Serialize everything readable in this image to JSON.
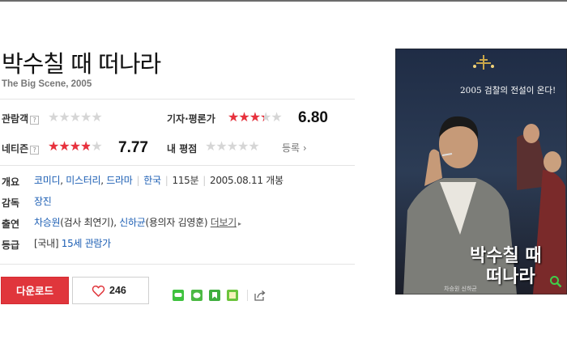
{
  "movie": {
    "title_ko": "박수칠 때 떠나라",
    "subtitle": "The Big Scene, 2005"
  },
  "ratings": {
    "audience_label": "관람객",
    "help_mark": "?",
    "audience_fraction": 0,
    "critic_label": "기자·평론가",
    "critic_score": "6.80",
    "critic_fraction": 0.68,
    "netizen_label": "네티즌",
    "netizen_score": "7.77",
    "netizen_fraction": 0.777,
    "my_label": "내 평점",
    "my_fraction": 0,
    "register_label": "등록",
    "register_arrow": "›",
    "star_glyphs": "★★★★★",
    "colors": {
      "star_red": "#e8313d",
      "star_gray": "#d6d6d6",
      "my_star": "#9aa6b3"
    }
  },
  "info": {
    "genre_label": "개요",
    "genres": [
      "코미디",
      "미스터리",
      "드라마"
    ],
    "country": "한국",
    "runtime": "115분",
    "release": "2005.08.11 개봉",
    "director_label": "감독",
    "director": "장진",
    "cast_label": "출연",
    "cast": [
      {
        "name": "차승원",
        "role": "(검사 최연기)"
      },
      {
        "name": "신하균",
        "role": "(용의자 김영훈)"
      }
    ],
    "more_label": "더보기",
    "more_arrow": "▸",
    "grade_label": "등급",
    "grade_region": "[국내]",
    "grade": "15세 관람가"
  },
  "actions": {
    "download_label": "다운로드",
    "like_count": "246",
    "share_icons": [
      "line-share-icon",
      "kakaotalk-share-icon",
      "bookmark-share-icon",
      "memo-share-icon",
      "share-export-icon"
    ],
    "colors": {
      "download_bg": "#e0363c",
      "heart": "#e0363c"
    }
  },
  "poster": {
    "headline": "2005 검찰의 전설이 온다!",
    "title_line1": "박수칠 때",
    "title_line2": "떠나라",
    "tagline": "차승원 신하균",
    "zoom_icon": "magnifier-icon"
  }
}
